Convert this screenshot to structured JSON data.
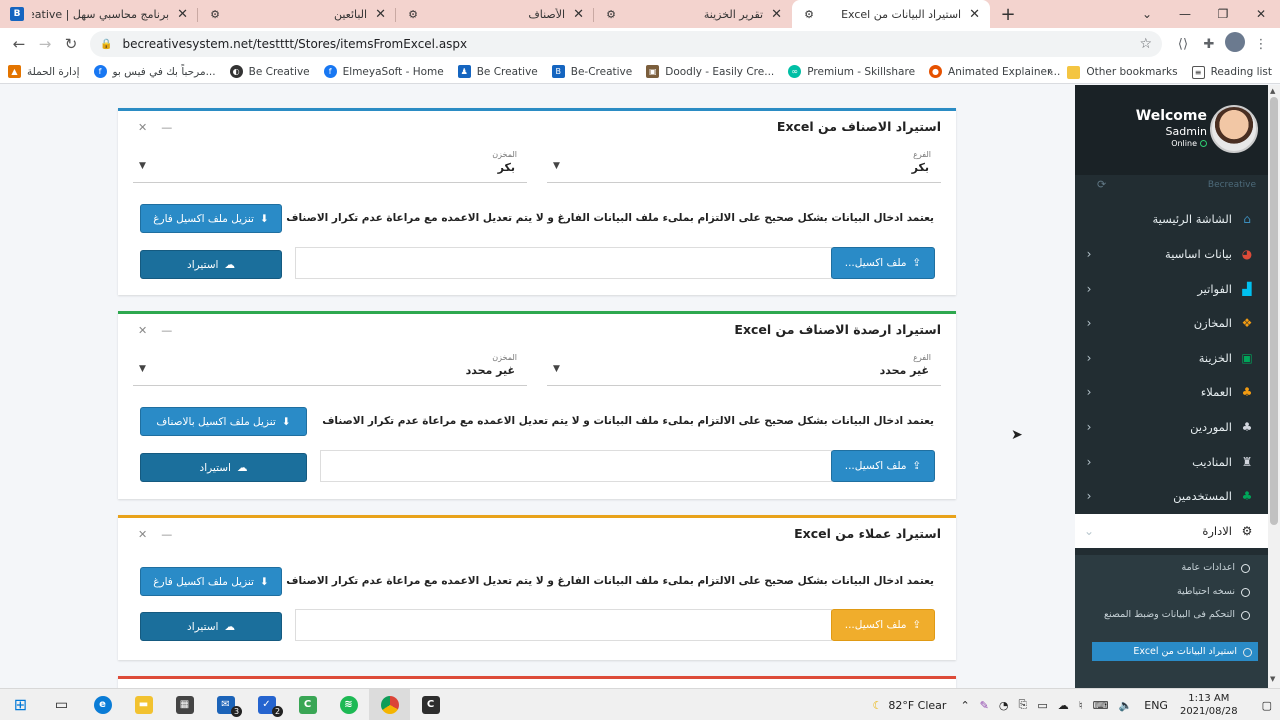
{
  "browser": {
    "tabs": [
      {
        "title": "برنامج محاسبي سهل | Be Creative",
        "icon": "b-icon",
        "active": false
      },
      {
        "title": "البائعين",
        "icon": "site-icon",
        "active": false
      },
      {
        "title": "الأصناف",
        "icon": "site-icon",
        "active": false
      },
      {
        "title": "تقرير الخزينة",
        "icon": "site-icon",
        "active": false
      },
      {
        "title": "استيراد البيانات من Excel",
        "icon": "site-icon",
        "active": true
      }
    ],
    "url": "becreativesystem.net/testttt/Stores/itemsFromExcel.aspx",
    "bookmarks": [
      {
        "label": "إدارة الحملة",
        "color": "#e37400"
      },
      {
        "label": "مرحباً بك في فيس بو...",
        "color": "#1877f2"
      },
      {
        "label": "Be Creative",
        "color": "#333333"
      },
      {
        "label": "ElmeyaSoft - Home",
        "color": "#1877f2"
      },
      {
        "label": "Be Creative",
        "color": "#1565c0"
      },
      {
        "label": "Be-Creative",
        "color": "#1565c0"
      },
      {
        "label": "Doodly - Easily Cre...",
        "color": "#7b5e3c"
      },
      {
        "label": "Premium - Skillshare",
        "color": "#00bfa5"
      },
      {
        "label": "Animated Explainer...",
        "color": "#e65100"
      }
    ],
    "bookmarks_right": [
      "Other bookmarks",
      "Reading list"
    ]
  },
  "cards": [
    {
      "title": "استيراد الاصناف من Excel",
      "border": "#2b8cc4",
      "branch_label": "الفرع",
      "branch_value": "بكر",
      "store_label": "المخزن",
      "store_value": "بكر",
      "download_label": "تنزيل ملف اكسيل فارغ",
      "note": "يعتمد ادخال البيانات بشكل صحيح على الالتزام بملىء ملف البيانات الفارغ و لا يتم تعديل الاعمده مع مراعاة عدم تكرار الاصناف",
      "file_label": "ملف اكسيل...",
      "import_label": "استيراد"
    },
    {
      "title": "استيراد ارصدة الاصناف من Excel",
      "border": "#2ea84f",
      "branch_label": "الفرع",
      "branch_value": "غير محدد",
      "store_label": "المخزن",
      "store_value": "غير محدد",
      "download_label": "تنزيل ملف اكسيل بالاصناف",
      "note": "يعتمد ادخال البيانات بشكل صحيح على الالتزام بملىء ملف البيانات و لا يتم تعديل الاعمده مع مراعاة عدم تكرار الاصناف",
      "file_label": "ملف اكسيل...",
      "import_label": "استيراد"
    },
    {
      "title": "استيراد عملاء من Excel",
      "border": "#e8a21a",
      "download_label": "تنزيل ملف اكسيل فارغ",
      "note": "يعتمد ادخال البيانات بشكل صحيح على الالتزام بملىء ملف البيانات الفارغ و لا يتم تعديل الاعمده مع مراعاة عدم تكرار الاصناف",
      "file_label": "ملف اكسيل...",
      "import_label": "استيراد"
    }
  ],
  "sidebar": {
    "welcome": "Welcome",
    "user": "Sadmin",
    "status": "Online",
    "brand": "Becreative",
    "items": [
      {
        "label": "الشاشة الرئيسية",
        "icon": "home-icon",
        "color": "#3c8dbc",
        "arrow": ""
      },
      {
        "label": "بيانات اساسية",
        "icon": "pie-chart-icon",
        "color": "#dd4b39",
        "arrow": "‹"
      },
      {
        "label": "الفواتير",
        "icon": "cart-icon",
        "color": "#00c0ef",
        "arrow": "‹"
      },
      {
        "label": "المخازن",
        "icon": "cubes-icon",
        "color": "#f39c12",
        "arrow": "‹"
      },
      {
        "label": "الخزينة",
        "icon": "money-icon",
        "color": "#00a65a",
        "arrow": "‹"
      },
      {
        "label": "العملاء",
        "icon": "users-icon",
        "color": "#f39c12",
        "arrow": "‹"
      },
      {
        "label": "الموردين",
        "icon": "users-icon",
        "color": "#d2d6de",
        "arrow": "‹"
      },
      {
        "label": "المناديب",
        "icon": "user-secret-icon",
        "color": "#d2d6de",
        "arrow": "‹"
      },
      {
        "label": "المستخدمين",
        "icon": "users-icon",
        "color": "#00a65a",
        "arrow": "‹"
      },
      {
        "label": "الادارة",
        "icon": "gears-icon",
        "color": "#222222",
        "arrow": "⌄"
      }
    ],
    "subitems": [
      {
        "label": "اعدادات عامة"
      },
      {
        "label": "نسخه احتياطية"
      },
      {
        "label": "التحكم فى البيانات وضبط المصنع"
      },
      {
        "label": "استيراد البيانات من Excel"
      }
    ]
  },
  "taskbar": {
    "weather": "82°F  Clear",
    "lang": "ENG",
    "time": "1:13 AM",
    "date": "2021/08/28",
    "mail_badge": "3",
    "todo_badge": "2"
  }
}
